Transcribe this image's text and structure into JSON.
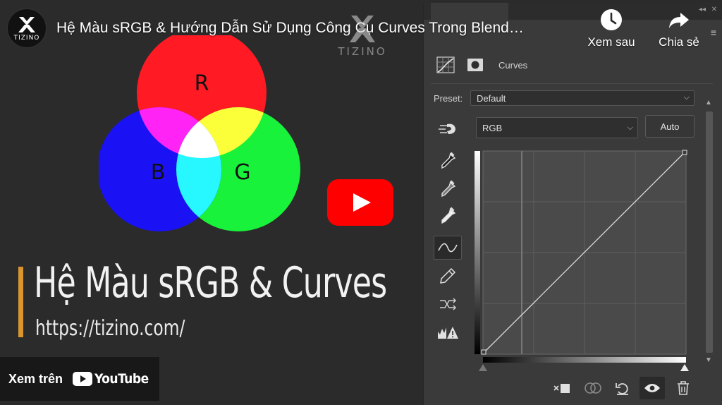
{
  "video": {
    "title": "Hệ Màu sRGB & Hướng Dẫn Sử Dụng Công Cụ Curves Trong Blend…",
    "channel_logo_text": "TIZINO",
    "watermark_text": "TIZINO"
  },
  "actions": {
    "watch_later_label": "Xem sau",
    "share_label": "Chia sẻ"
  },
  "watch_on": {
    "label": "Xem trên",
    "brand": "YouTube"
  },
  "thumbnail": {
    "heading": "Hệ Màu sRGB & Curves",
    "url": "https://tizino.com/",
    "rgb_labels": {
      "r": "R",
      "g": "G",
      "b": "B"
    }
  },
  "ps_panel": {
    "adjustment_name": "Curves",
    "preset_label": "Preset:",
    "preset_value": "Default",
    "channel_value": "RGB",
    "auto_label": "Auto"
  },
  "colors": {
    "red": "#ff1a24",
    "green": "#19f23a",
    "blue": "#1a12f5",
    "accent_bar": "#d9962f",
    "youtube_red": "#ff0000"
  }
}
